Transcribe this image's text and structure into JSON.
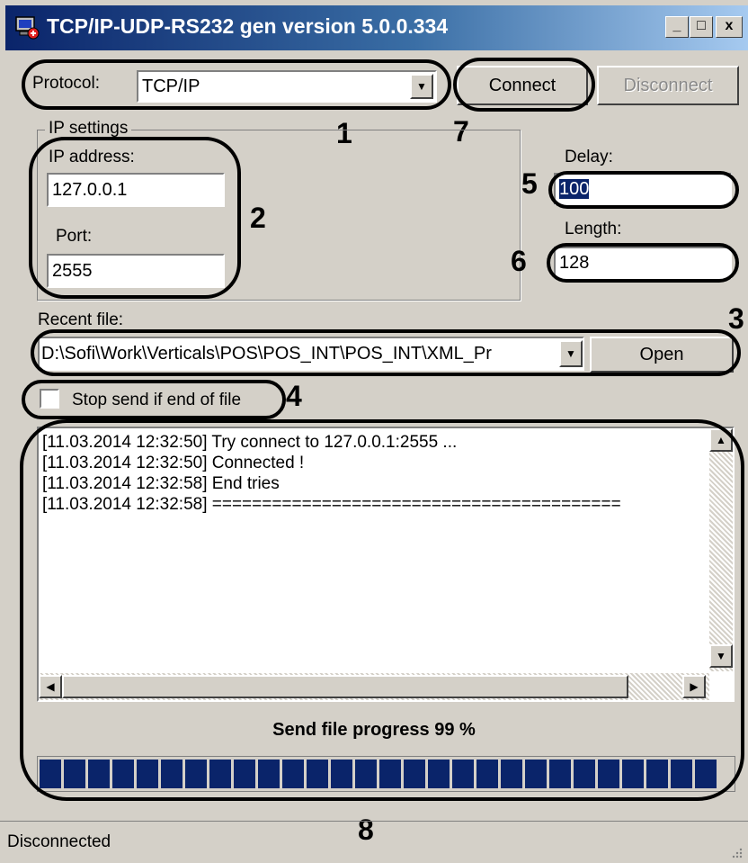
{
  "window": {
    "title": "TCP/IP-UDP-RS232 gen version 5.0.0.334",
    "minimize_glyph": "_",
    "maximize_glyph": "□",
    "close_glyph": "x"
  },
  "protocol": {
    "label": "Protocol:",
    "value": "TCP/IP"
  },
  "buttons": {
    "connect": "Connect",
    "disconnect": "Disconnect",
    "open": "Open"
  },
  "ip_settings": {
    "group_label": "IP settings",
    "ip_label": "IP address:",
    "ip_value": "127.0.0.1",
    "port_label": "Port:",
    "port_value": "2555"
  },
  "delay": {
    "label": "Delay:",
    "value": "100"
  },
  "length": {
    "label": "Length:",
    "value": "128"
  },
  "recent_file": {
    "label": "Recent file:",
    "value": "D:\\Sofi\\Work\\Verticals\\POS\\POS_INT\\POS_INT\\XML_Pr"
  },
  "stop_send": {
    "label": "Stop send if end of file",
    "checked": false
  },
  "log": [
    "[11.03.2014 12:32:50] Try connect to 127.0.0.1:2555 ...",
    "[11.03.2014 12:32:50] Connected !",
    "[11.03.2014 12:32:58] End tries",
    "[11.03.2014 12:32:58] ========================================="
  ],
  "progress": {
    "label": "Send file progress 99 %",
    "value": 0.99,
    "color": "#0a246a"
  },
  "status": "Disconnected",
  "callouts": [
    "1",
    "2",
    "3",
    "4",
    "5",
    "6",
    "7",
    "8"
  ],
  "colors": {
    "title_start": "#0a246a",
    "title_end": "#a6caf0",
    "face": "#d4d0c8",
    "selection": "#0a246a"
  }
}
